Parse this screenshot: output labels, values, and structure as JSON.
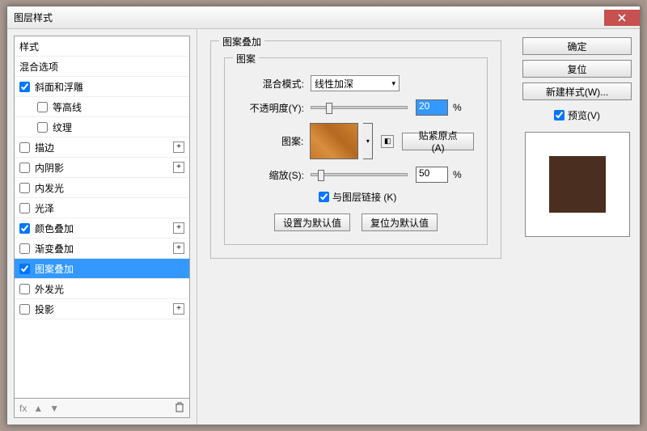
{
  "window": {
    "title": "图层样式"
  },
  "sidebar": {
    "items": [
      {
        "label": "样式",
        "type": "header"
      },
      {
        "label": "混合选项",
        "type": "header"
      },
      {
        "label": "斜面和浮雕",
        "checked": true,
        "plus": false
      },
      {
        "label": "等高线",
        "checked": false,
        "sub": true
      },
      {
        "label": "纹理",
        "checked": false,
        "sub": true
      },
      {
        "label": "描边",
        "checked": false,
        "plus": true
      },
      {
        "label": "内阴影",
        "checked": false,
        "plus": true
      },
      {
        "label": "内发光",
        "checked": false
      },
      {
        "label": "光泽",
        "checked": false
      },
      {
        "label": "颜色叠加",
        "checked": true,
        "plus": true
      },
      {
        "label": "渐变叠加",
        "checked": false,
        "plus": true
      },
      {
        "label": "图案叠加",
        "checked": true,
        "selected": true
      },
      {
        "label": "外发光",
        "checked": false
      },
      {
        "label": "投影",
        "checked": false,
        "plus": true
      }
    ],
    "footer_fx": "fx"
  },
  "panel": {
    "title": "图案叠加",
    "group_title": "图案",
    "blend_label": "混合模式:",
    "blend_value": "线性加深",
    "opacity_label": "不透明度(Y):",
    "opacity_value": "20",
    "pattern_label": "图案:",
    "snap_btn": "贴紧原点 (A)",
    "scale_label": "缩放(S):",
    "scale_value": "50",
    "percent": "%",
    "link_label": "与图层链接 (K)",
    "set_default": "设置为默认值",
    "reset_default": "复位为默认值"
  },
  "right": {
    "ok": "确定",
    "reset": "复位",
    "new_style": "新建样式(W)...",
    "preview": "预览(V)"
  }
}
